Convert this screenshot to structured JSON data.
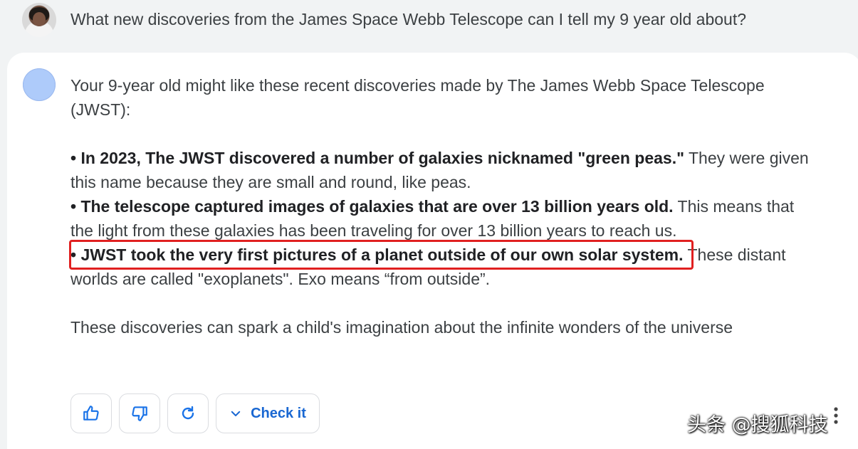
{
  "prompt": {
    "text": "What new discoveries from the James Space Webb Telescope can I tell my 9 year old about?"
  },
  "response": {
    "intro_line1": "Your 9-year old might like these recent discoveries made by The James Webb Space Telescope",
    "intro_line2": "(JWST):",
    "bullets": [
      {
        "bold": "• In 2023, The JWST discovered a number of galaxies nicknamed \"green peas.\"",
        "rest_line1": " They were given",
        "rest_line2": "this name because they are small and round, like peas."
      },
      {
        "bold": "• The telescope captured images of galaxies that are over 13 billion years old.",
        "rest_line1": " This means that",
        "rest_line2": "the light from these galaxies has been traveling for over 13 billion years to reach us."
      },
      {
        "bold": "• JWST took the very first pictures of a planet outside of our own solar system.",
        "rest_line1": " These distant",
        "rest_line2": "worlds are called \"exoplanets\". Exo means “from outside”."
      }
    ],
    "closing": "These discoveries can spark a child's imagination about the infinite wonders of the universe"
  },
  "actions": {
    "thumbs_up_icon": "thumbs-up-icon",
    "thumbs_down_icon": "thumbs-down-icon",
    "regenerate_icon": "refresh-icon",
    "check_label": "Check it"
  },
  "watermark": {
    "text": "头条 @搜狐科技"
  },
  "colors": {
    "highlight": "#e02020",
    "accent": "#1a73e8",
    "avatar_bard": "#aecbfa"
  }
}
